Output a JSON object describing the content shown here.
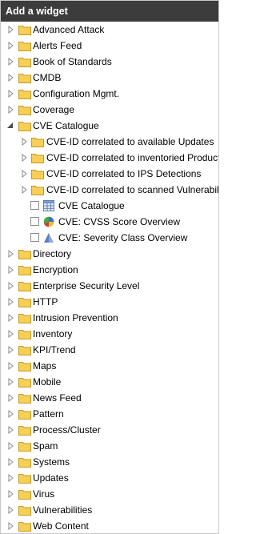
{
  "header": {
    "title": "Add a widget"
  },
  "tree": {
    "items": [
      {
        "label": "Advanced Attack"
      },
      {
        "label": "Alerts Feed"
      },
      {
        "label": "Book of Standards"
      },
      {
        "label": "CMDB"
      },
      {
        "label": "Configuration Mgmt."
      },
      {
        "label": "Coverage"
      },
      {
        "label": "CVE Catalogue"
      },
      {
        "label": "CVE-ID correlated to available Updates"
      },
      {
        "label": "CVE-ID correlated to inventoried Products"
      },
      {
        "label": "CVE-ID correlated to IPS Detections"
      },
      {
        "label": "CVE-ID correlated to scanned Vulnerabilities"
      },
      {
        "label": "CVE Catalogue",
        "icon": "table-icon"
      },
      {
        "label": "CVE: CVSS Score Overview",
        "icon": "pie-chart-icon"
      },
      {
        "label": "CVE: Severity Class Overview",
        "icon": "pyramid-chart-icon"
      },
      {
        "label": "Directory"
      },
      {
        "label": "Encryption"
      },
      {
        "label": "Enterprise Security Level"
      },
      {
        "label": "HTTP"
      },
      {
        "label": "Intrusion Prevention"
      },
      {
        "label": "Inventory"
      },
      {
        "label": "KPI/Trend"
      },
      {
        "label": "Maps"
      },
      {
        "label": "Mobile"
      },
      {
        "label": "News Feed"
      },
      {
        "label": "Pattern"
      },
      {
        "label": "Process/Cluster"
      },
      {
        "label": "Spam"
      },
      {
        "label": "Systems"
      },
      {
        "label": "Updates"
      },
      {
        "label": "Virus"
      },
      {
        "label": "Vulnerabilities"
      },
      {
        "label": "Web Content"
      }
    ]
  },
  "colors": {
    "header_bg": "#3c3c3c",
    "folder_fill": "#f6cf57",
    "folder_stroke": "#c99a1f"
  }
}
